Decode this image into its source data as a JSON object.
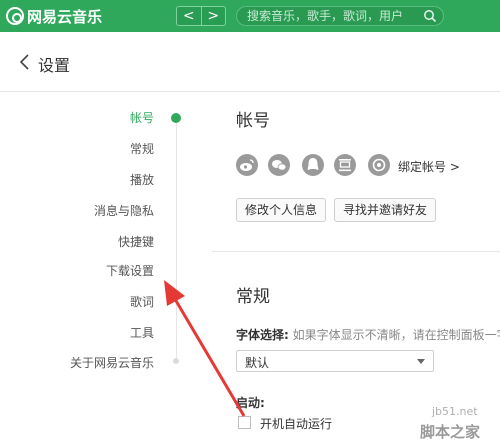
{
  "app": {
    "name": "网易云音乐"
  },
  "nav": {
    "back": "<",
    "forward": ">"
  },
  "search": {
    "placeholder": "搜索音乐，歌手，歌词，用户"
  },
  "header": {
    "title": "设置"
  },
  "sidebar": {
    "items": [
      {
        "label": "帐号",
        "active": true
      },
      {
        "label": "常规"
      },
      {
        "label": "播放"
      },
      {
        "label": "消息与隐私"
      },
      {
        "label": "快捷键"
      },
      {
        "label": "下载设置"
      },
      {
        "label": "歌词"
      },
      {
        "label": "工具"
      },
      {
        "label": "关于网易云音乐"
      }
    ]
  },
  "account": {
    "title": "帐号",
    "social_icons": [
      "weibo-icon",
      "wechat-icon",
      "qq-icon",
      "douban-icon",
      "netease-icon"
    ],
    "bind_link": "绑定帐号 >",
    "edit_profile": "修改个人信息",
    "find_friends": "寻找并邀请好友"
  },
  "general": {
    "title": "常规",
    "font_label": "字体选择:",
    "font_hint": "如果字体显示不清晰，请在控制面板一字",
    "font_value": "默认",
    "startup_label": "启动:",
    "autostart_label": "开机自动运行",
    "autostart_checked": false
  },
  "watermark": {
    "line1": "jb51.net",
    "line2": "脚本之家"
  },
  "colors": {
    "brand": "#2fa85c",
    "annotation": "#e53935"
  }
}
